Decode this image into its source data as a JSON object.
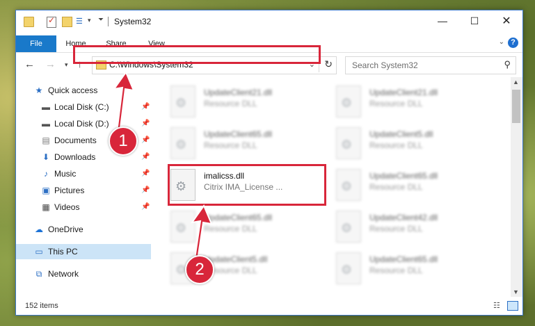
{
  "window": {
    "title": "System32",
    "controls": {
      "minimize": "—",
      "maximize": "☐",
      "close": "✕"
    }
  },
  "ribbon": {
    "tabs": [
      "File",
      "Home",
      "Share",
      "View"
    ]
  },
  "address_bar": {
    "path": "C:\\Windows\\System32"
  },
  "search": {
    "placeholder": "Search System32"
  },
  "sidebar": {
    "items": [
      {
        "label": "Quick access",
        "icon": "star-icon",
        "pinned": false
      },
      {
        "label": "Local Disk (C:)",
        "icon": "drive-icon",
        "pinned": true
      },
      {
        "label": "Local Disk (D:)",
        "icon": "drive-icon",
        "pinned": true
      },
      {
        "label": "Documents",
        "icon": "documents-icon",
        "pinned": true
      },
      {
        "label": "Downloads",
        "icon": "download-icon",
        "pinned": true
      },
      {
        "label": "Music",
        "icon": "music-icon",
        "pinned": true
      },
      {
        "label": "Pictures",
        "icon": "pictures-icon",
        "pinned": true
      },
      {
        "label": "Videos",
        "icon": "videos-icon",
        "pinned": true
      },
      {
        "label": "OneDrive",
        "icon": "cloud-icon",
        "pinned": false
      },
      {
        "label": "This PC",
        "icon": "computer-icon",
        "pinned": false,
        "selected": true
      },
      {
        "label": "Network",
        "icon": "network-icon",
        "pinned": false
      }
    ]
  },
  "files": {
    "left": [
      {
        "name": "UpdateClient21.dll",
        "type": "Resource DLL"
      },
      {
        "name": "UpdateClient65.dll",
        "type": "Resource DLL"
      },
      {
        "name": "imalicss.dll",
        "type": "Citrix IMA_License ..."
      },
      {
        "name": "UpdateClient65.dll",
        "type": "Resource DLL"
      },
      {
        "name": "UpdateClient5.dll",
        "type": "Resource DLL"
      }
    ],
    "right": [
      {
        "name": "UpdateClient21.dll",
        "type": "Resource DLL"
      },
      {
        "name": "UpdateClient5.dll",
        "type": "Resource DLL"
      },
      {
        "name": "UpdateClient65.dll",
        "type": "Resource DLL"
      },
      {
        "name": "UpdateClient42.dll",
        "type": "Resource DLL"
      },
      {
        "name": "UpdateClient65.dll",
        "type": "Resource DLL"
      }
    ]
  },
  "status": {
    "item_count": "152 items"
  },
  "callouts": {
    "step1": "1",
    "step2": "2",
    "color": "#d8263a"
  }
}
